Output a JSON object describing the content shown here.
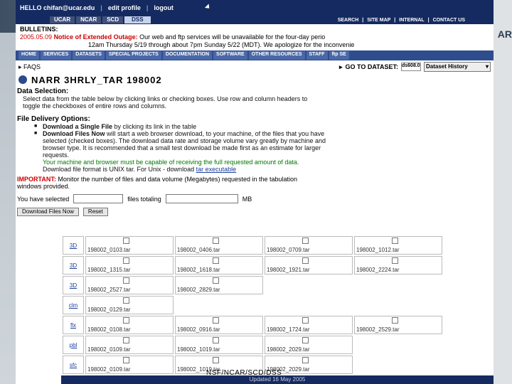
{
  "header": {
    "user": "HELLO chifan@ucar.edu",
    "edit_profile": "edit profile",
    "logout": "logout",
    "tabs": [
      "UCAR",
      "NCAR",
      "SCD",
      "DSS"
    ],
    "toplinks": [
      "SEARCH",
      "SITE MAP",
      "INTERNAL",
      "CONTACT US"
    ],
    "edge_text": "AR"
  },
  "bulletin": {
    "label": "BULLETINS:",
    "date": "2005.05.09",
    "notice": "Notice of Extended Outage:",
    "line1": "Our web and ftp services will be unavailable for the four-day perio",
    "line2": "12am Thursday 5/19 through about 7pm Sunday 5/22 (MDT). We apologize for the inconvenie"
  },
  "nav": [
    "HOME",
    "SERVICES",
    "DATASETS",
    "SPECIAL PROJECTS",
    "DOCUMENTATION",
    "SOFTWARE",
    "OTHER RESOURCES",
    "STAFF",
    "ftp SE"
  ],
  "faq_label": "FAQS",
  "goto": {
    "label": "GO TO DATASET:",
    "input_value": "ds608.0",
    "select_value": "Dataset History"
  },
  "page_title": "NARR 3HRLY_TAR 198002",
  "data_selection": {
    "heading": "Data Selection:",
    "text1": "Select data from the table below by clicking links or checking boxes. Use row and column headers to",
    "text2": "toggle the checkboxes of entire rows and columns."
  },
  "delivery": {
    "heading": "File Delivery Options:",
    "single_bold": "Download a Single File",
    "single_rest": " by clicking its link in the table",
    "now_bold": "Download Files Now",
    "now_rest": " will start a web browser download, to your machine, of the files that you have",
    "cont1": "selected (checked boxes). The download data rate and storage volume vary greatly by machine and",
    "cont2": "browser type. It is recommended that a small test download be made first as an estimate for larger",
    "cont3": "requests.",
    "green": "Your machine and browser must be capable of receiving the full requested amount of data.",
    "format_text": "Download file format is UNIX tar. For Unix - download ",
    "tar_link": "tar executable"
  },
  "important": {
    "label": "IMPORTANT:",
    "text1": "Monitor the number of files and data volume (Megabytes) requested in the tabulation",
    "text2": "windows provided."
  },
  "selection": {
    "prefix": "You have selected",
    "middle": "files totaling",
    "suffix": "MB"
  },
  "buttons": {
    "download": "Download Files Now",
    "reset": "Reset"
  },
  "files": [
    {
      "cat": "3D",
      "names": [
        "198002_0103.tar",
        "198002_0406.tar",
        "198002_0709.tar",
        "198002_1012.tar"
      ]
    },
    {
      "cat": "3D",
      "names": [
        "198002_1315.tar",
        "198002_1618.tar",
        "198002_1921.tar",
        "198002_2224.tar"
      ]
    },
    {
      "cat": "3D",
      "names": [
        "198002_2527.tar",
        "198002_2829.tar"
      ]
    },
    {
      "cat": "clm",
      "names": [
        "198002_0129.tar"
      ]
    },
    {
      "cat": "flx",
      "names": [
        "198002_0108.tar",
        "198002_0916.tar",
        "198002_1724.tar",
        "198002_2529.tar"
      ]
    },
    {
      "cat": "pbl",
      "names": [
        "198002_0109.tar",
        "198002_1019.tar",
        "198002_2029.tar"
      ]
    },
    {
      "cat": "sfc",
      "names": [
        "198002_0109.tar",
        "198002_1019.tar",
        "198002_2029.tar"
      ]
    }
  ],
  "footer": {
    "updated": "Updated 16 May 2005",
    "label": "NSF/NCAR/SCD/DSS"
  }
}
